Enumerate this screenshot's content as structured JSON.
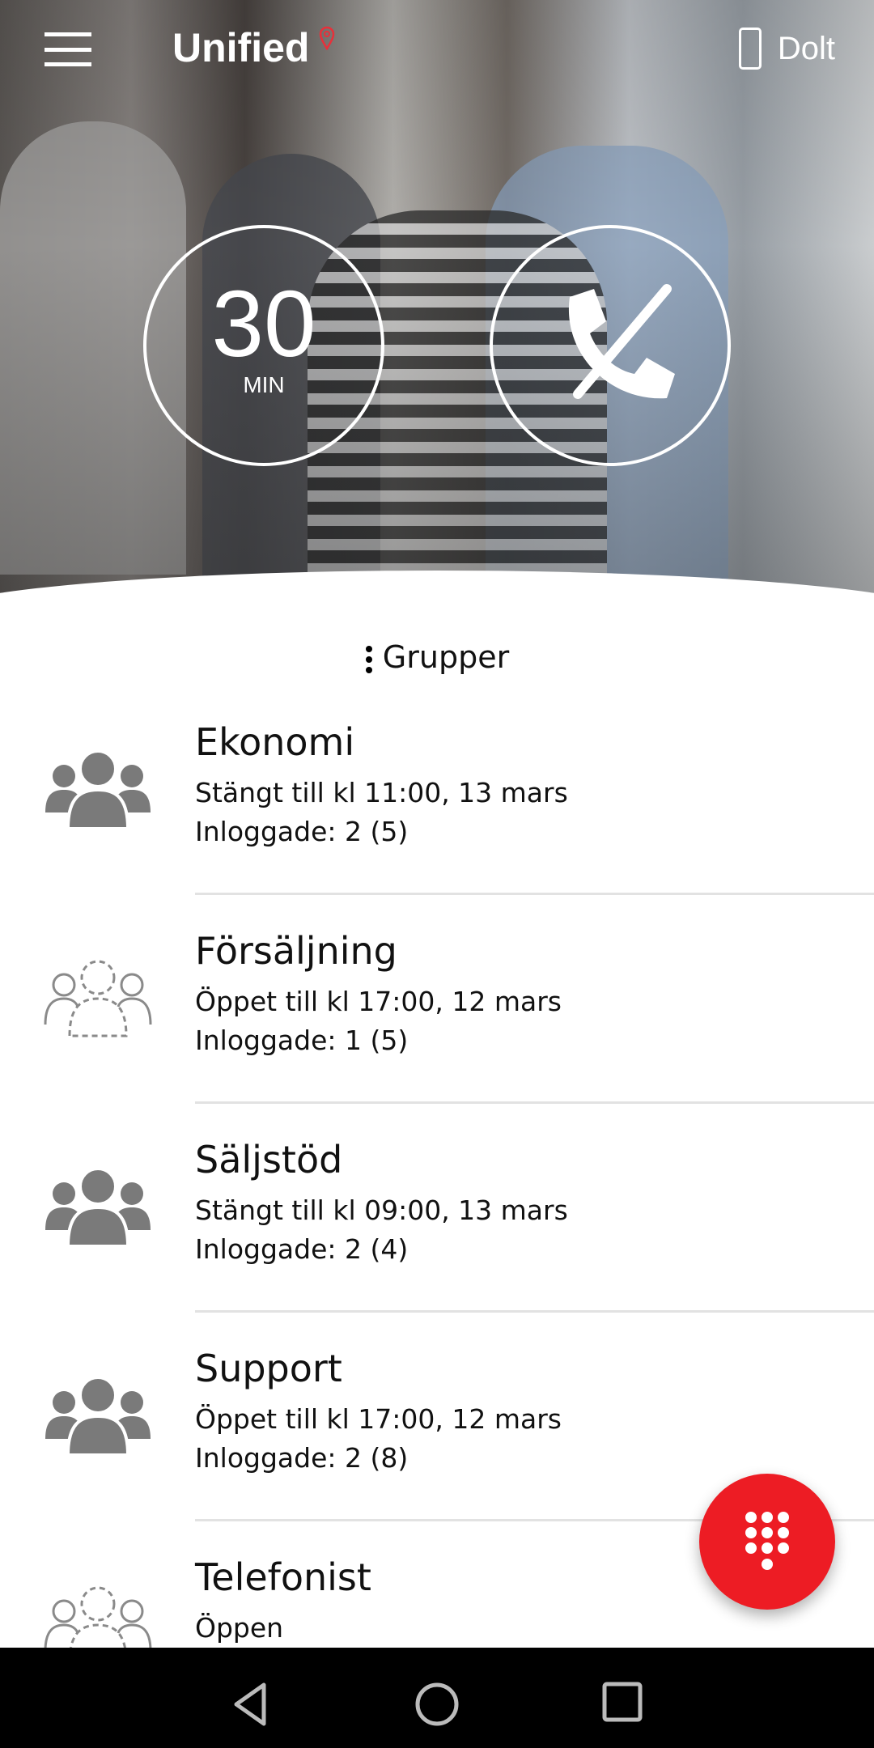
{
  "header": {
    "logo": "Unified",
    "status_label": "Dolt",
    "icons": [
      "menu-icon",
      "location-pin-icon",
      "phone-device-icon"
    ]
  },
  "hero": {
    "timer_value": "30",
    "timer_unit": "MIN",
    "call_button_icon": "phone-off-icon"
  },
  "groups_label": "Grupper",
  "groups": [
    {
      "name": "Ekonomi",
      "status": "Stängt till kl 11:00, 13 mars",
      "logged_in": "Inloggade: 2 (5)",
      "icon": "group-filled-icon"
    },
    {
      "name": "Försäljning",
      "status": "Öppet till kl 17:00, 12 mars",
      "logged_in": "Inloggade: 1 (5)",
      "icon": "group-dashed-icon"
    },
    {
      "name": "Säljstöd",
      "status": "Stängt till kl 09:00, 13 mars",
      "logged_in": "Inloggade: 2 (4)",
      "icon": "group-filled-icon"
    },
    {
      "name": "Support",
      "status": "Öppet till kl 17:00, 12 mars",
      "logged_in": "Inloggade: 2 (8)",
      "icon": "group-filled-icon"
    },
    {
      "name": "Telefonist",
      "status": "Öppen",
      "logged_in": "",
      "icon": "group-dashed-icon"
    }
  ],
  "fab": {
    "icon": "dialpad-icon",
    "color": "#ed1c24"
  },
  "navbar": {
    "icons": [
      "back-icon",
      "home-icon",
      "recents-icon"
    ]
  }
}
